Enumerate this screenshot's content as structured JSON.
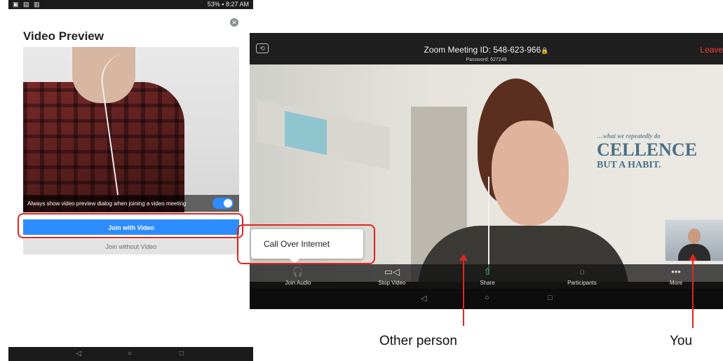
{
  "phone": {
    "status_right": "53% ▪ 8:27 AM",
    "preview_title": "Video Preview",
    "toggle_label": "Always show video preview dialog when joining a video meeting",
    "toggle_on": true,
    "join_with_video": "Join with Video",
    "join_without_video": "Join without Video"
  },
  "meeting": {
    "meeting_id": "Zoom Meeting ID: 548-623-966",
    "lock_icon": "🔒",
    "password": "Password: 627249",
    "leave": "Leave",
    "wall_text_line1": "…what we repeatedly do",
    "wall_text_line2": "CELLENCE",
    "wall_text_line3": "BUT A HABIT.",
    "popup_label": "Call Over Internet",
    "toolbar": [
      {
        "label": "Join Audio",
        "icon": "headphones-icon"
      },
      {
        "label": "Stop Video",
        "icon": "video-camera-icon"
      },
      {
        "label": "Share",
        "icon": "share-icon"
      },
      {
        "label": "Participants",
        "icon": "participants-icon"
      },
      {
        "label": "More",
        "icon": "more-icon"
      }
    ]
  },
  "annotations": {
    "other_person": "Other person",
    "you": "You"
  },
  "colors": {
    "accent_blue": "#2d8cff",
    "leave_red": "#ff3b30",
    "annotation_red": "#e0261e"
  }
}
